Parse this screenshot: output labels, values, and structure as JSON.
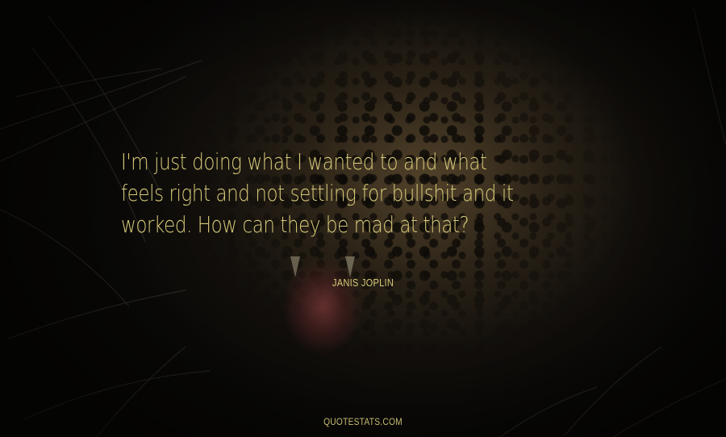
{
  "quote": {
    "lines": [
      "I'm just doing what I wanted to and what",
      "feels right and not settling for bullshit and it",
      "worked. How can they be mad at that?"
    ]
  },
  "author": "JANIS JOPLIN",
  "footer": "QUOTESTATS.COM",
  "colors": {
    "text": "#d7ca7a",
    "background": "#0b0a08"
  }
}
